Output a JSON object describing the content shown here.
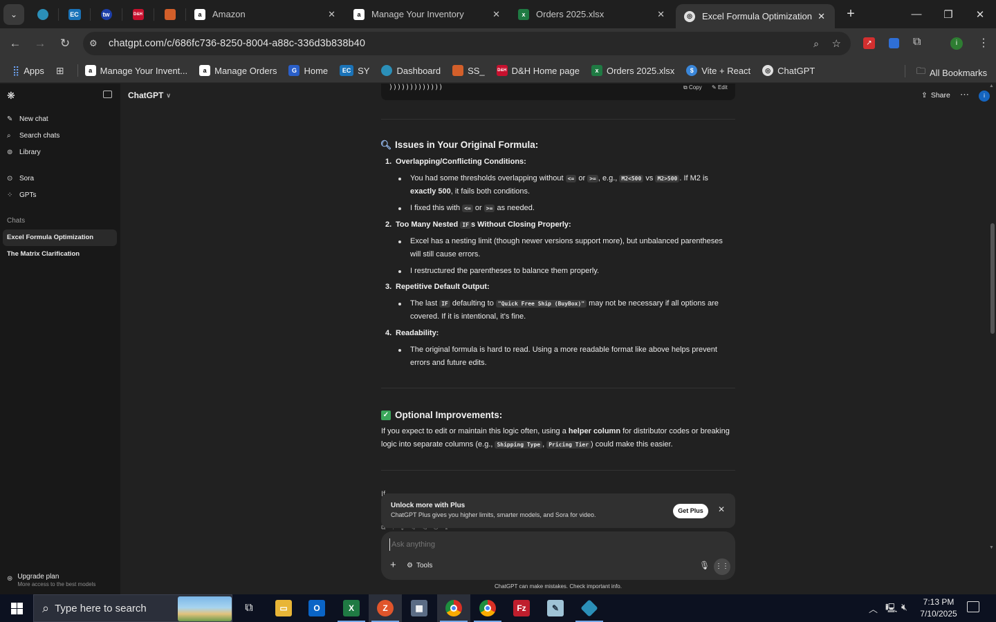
{
  "browser": {
    "tabs": [
      {
        "title": "Amazon",
        "icon": "amazon-icon"
      },
      {
        "title": "Manage Your Inventory",
        "icon": "amazon-icon"
      },
      {
        "title": "Orders 2025.xlsx",
        "icon": "excel-icon"
      },
      {
        "title": "Excel Formula Optimization",
        "icon": "chatgpt-icon"
      }
    ],
    "pinned_tabs": [
      {
        "label": "",
        "icon": "app-icon",
        "color": "#2b8fb8"
      },
      {
        "label": "EC",
        "icon": "ec-icon",
        "color": "#1a73b8"
      },
      {
        "label": "tw",
        "icon": "tw-icon",
        "color": "#1d3ea8"
      },
      {
        "label": "D&H",
        "icon": "dh-icon",
        "color": "#c8102e"
      },
      {
        "label": "",
        "icon": "stack-icon",
        "color": "#d35f2a"
      }
    ],
    "url": "chatgpt.com/c/686fc736-8250-8004-a88c-336d3b838b40",
    "profile_initial": "i",
    "bookmarks": [
      {
        "label": "Apps",
        "icon": "apps-grid-icon"
      },
      {
        "label": "",
        "icon": "tab-groups-icon"
      },
      {
        "label": "Manage Your Invent...",
        "icon": "amazon-icon"
      },
      {
        "label": "Manage Orders",
        "icon": "amazon-icon"
      },
      {
        "label": "Home",
        "icon": "home-icon"
      },
      {
        "label": "SY",
        "icon": "ec-icon"
      },
      {
        "label": "Dashboard",
        "icon": "dashboard-icon"
      },
      {
        "label": "SS_",
        "icon": "stack-icon"
      },
      {
        "label": "D&H Home page",
        "icon": "dh-icon"
      },
      {
        "label": "Orders 2025.xlsx",
        "icon": "excel-icon"
      },
      {
        "label": "Vite + React",
        "icon": "dollar-icon"
      },
      {
        "label": "ChatGPT",
        "icon": "chatgpt-icon"
      }
    ],
    "all_bookmarks": "All Bookmarks"
  },
  "sidebar": {
    "nav": [
      {
        "label": "New chat",
        "icon": "new-chat-icon"
      },
      {
        "label": "Search chats",
        "icon": "search-icon"
      },
      {
        "label": "Library",
        "icon": "library-icon"
      },
      {
        "label": "Sora",
        "icon": "sora-icon"
      },
      {
        "label": "GPTs",
        "icon": "gpts-icon"
      }
    ],
    "chats_heading": "Chats",
    "chats": [
      {
        "label": "Excel Formula Optimization",
        "active": true
      },
      {
        "label": "The Matrix Clarification",
        "active": false
      }
    ],
    "upgrade_title": "Upgrade plan",
    "upgrade_subtitle": "More access to the best models"
  },
  "header": {
    "model": "ChatGPT",
    "share": "Share",
    "profile_initial": "i"
  },
  "message": {
    "code_tail": ")))))))))))))",
    "copy": "Copy",
    "edit": "Edit",
    "issues_heading": "Issues in Your Original Formula:",
    "items": [
      {
        "num": "1.",
        "title": "Overlapping/Conflicting Conditions:"
      },
      {
        "num": "2.",
        "title_pre": "Too Many Nested ",
        "title_code": "IF",
        "title_post": "s Without Closing Properly:"
      },
      {
        "num": "3.",
        "title": "Repetitive Default Output:"
      },
      {
        "num": "4.",
        "title": "Readability:"
      }
    ],
    "b1a_1": "You had some thresholds overlapping without ",
    "b1a_c1": "<=",
    "b1a_2": " or ",
    "b1a_c2": ">=",
    "b1a_3": ", e.g., ",
    "b1a_c3": "M2<500",
    "b1a_4": " vs ",
    "b1a_c4": "M2>500",
    "b1a_5": ". If M2 is ",
    "b1a_b": "exactly 500",
    "b1a_6": ", it fails both conditions.",
    "b1b_1": "I fixed this with ",
    "b1b_c1": "<=",
    "b1b_2": " or ",
    "b1b_c2": ">=",
    "b1b_3": " as needed.",
    "b2a": "Excel has a nesting limit (though newer versions support more), but unbalanced parentheses will still cause errors.",
    "b2b": "I restructured the parentheses to balance them properly.",
    "b3a_1": "The last ",
    "b3a_c1": "IF",
    "b3a_2": " defaulting to ",
    "b3a_c2": "\"Quick Free Ship (BuyBox)\"",
    "b3a_3": " may not be necessary if all options are covered. If it is intentional, it's fine.",
    "b4a": "The original formula is hard to read. Using a more readable format like above helps prevent errors and future edits.",
    "optional_heading": "Optional Improvements:",
    "opt_1": "If you expect to edit or maintain this logic often, using a ",
    "opt_b": "helper column",
    "opt_2": " for distributor codes or breaking logic into separate columns (e.g., ",
    "opt_c1": "Shipping Type",
    "opt_3": ", ",
    "opt_c2": "Pricing Tier",
    "opt_4": ") could make this easier.",
    "cut_text": "If"
  },
  "upsell": {
    "title": "Unlock more with Plus",
    "subtitle": "ChatGPT Plus gives you higher limits, smarter models, and Sora for video.",
    "button": "Get Plus"
  },
  "composer": {
    "placeholder": "Ask anything",
    "tools": "Tools",
    "disclaimer": "ChatGPT can make mistakes. Check important info."
  },
  "taskbar": {
    "search_placeholder": "Type here to search",
    "time": "7:13 PM",
    "date": "7/10/2025"
  }
}
